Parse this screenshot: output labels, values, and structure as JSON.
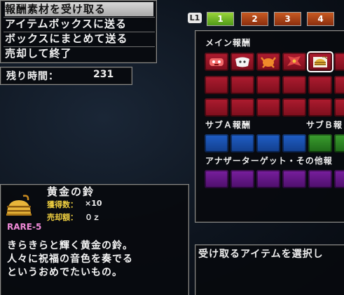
{
  "menu": {
    "items": [
      {
        "label": "報酬素材を受け取る"
      },
      {
        "label": "アイテムボックスに送る"
      },
      {
        "label": "ボックスにまとめて送る"
      },
      {
        "label": "売却して終了"
      }
    ],
    "selected_index": 0
  },
  "time": {
    "label": "残り時間：",
    "value": "231"
  },
  "tabs": {
    "button_hint": "L1",
    "pages": [
      {
        "label": "1",
        "active": true
      },
      {
        "label": "2",
        "active": false
      },
      {
        "label": "3",
        "active": false
      },
      {
        "label": "4",
        "active": false
      }
    ]
  },
  "rewards": {
    "main_label": "メイン報酬",
    "sub_a_label": "サブＡ報酬",
    "sub_b_label": "サブＢ報",
    "other_label": "アナザーターゲット・その他報",
    "main_icons": [
      "monster-part-icon",
      "white-hide-icon",
      "orange-claw-icon",
      "red-wing-icon",
      "golden-bell-icon"
    ],
    "colors": {
      "main": "#a01828",
      "sub_a": "#1d55b8",
      "sub_b": "#34902a",
      "other": "#6a1a90"
    }
  },
  "detail": {
    "name": "黄金の鈴",
    "count_label": "獲得数：",
    "count_value": "×10",
    "price_label": "売却額：",
    "price_value": "０ｚ",
    "rarity": "RARE-5",
    "description": [
      "きらきらと輝く黄金の鈴。",
      "人々に祝福の音色を奏でる",
      "というおめでたいもの。"
    ]
  },
  "hint": {
    "text": "受け取るアイテムを選択し"
  }
}
